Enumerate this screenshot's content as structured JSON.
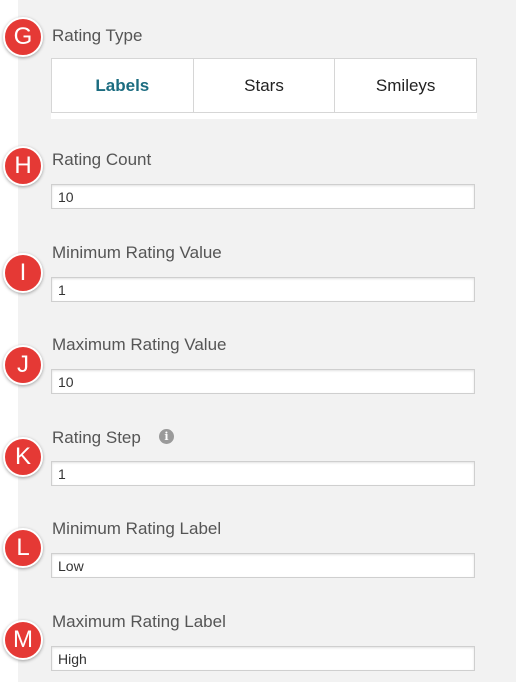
{
  "rating_type": {
    "label": "Rating Type",
    "badge": "G",
    "options": [
      "Labels",
      "Stars",
      "Smileys"
    ],
    "selected": "Labels"
  },
  "rating_count": {
    "label": "Rating Count",
    "badge": "H",
    "value": "10"
  },
  "min_value": {
    "label": "Minimum Rating Value",
    "badge": "I",
    "value": "1"
  },
  "max_value": {
    "label": "Maximum Rating Value",
    "badge": "J",
    "value": "10"
  },
  "step": {
    "label": "Rating Step",
    "badge": "K",
    "value": "1",
    "info_icon": "info-icon"
  },
  "min_label": {
    "label": "Minimum Rating Label",
    "badge": "L",
    "value": "Low"
  },
  "max_label": {
    "label": "Maximum Rating Label",
    "badge": "M",
    "value": "High"
  },
  "colors": {
    "badge": "#e53935",
    "active_tab": "#1b6c80",
    "panel_bg": "#f2f2f2"
  }
}
